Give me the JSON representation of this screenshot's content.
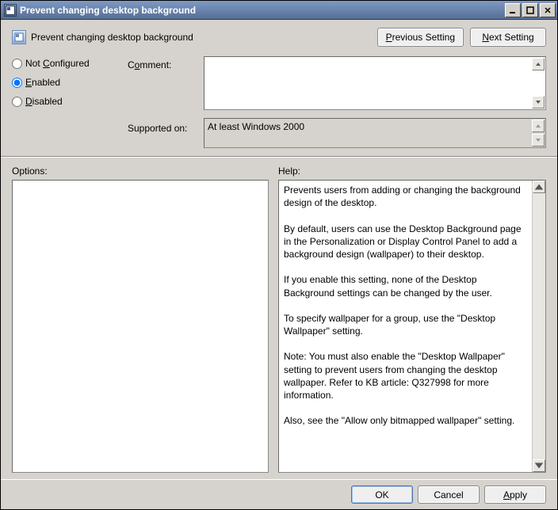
{
  "window": {
    "title": "Prevent changing desktop background"
  },
  "header": {
    "policy_name": "Prevent changing desktop background",
    "previous_label": "Previous Setting",
    "previous_hotkey": "P",
    "next_label": "Next Setting",
    "next_hotkey": "N"
  },
  "state": {
    "not_configured_label": "Not Configured",
    "not_configured_hotkey": "C",
    "enabled_label": "Enabled",
    "enabled_hotkey": "E",
    "disabled_label": "Disabled",
    "disabled_hotkey": "D",
    "selected": "enabled"
  },
  "comment": {
    "label": "Comment:",
    "hotkey": "o",
    "value": ""
  },
  "supported": {
    "label": "Supported on:",
    "value": "At least Windows 2000"
  },
  "panels": {
    "options_label": "Options:",
    "help_label": "Help:"
  },
  "help_text": "Prevents users from adding or changing the background design of the desktop.\n\nBy default, users can use the Desktop Background page in the Personalization or Display Control Panel to add a background design (wallpaper) to their desktop.\n\nIf you enable this setting, none of the Desktop Background settings can be changed by the user.\n\nTo specify wallpaper for a group, use the \"Desktop Wallpaper\" setting.\n\nNote: You must also enable the \"Desktop Wallpaper\" setting to prevent users from changing the desktop wallpaper. Refer to KB article: Q327998 for more information.\n\nAlso, see the \"Allow only bitmapped wallpaper\" setting.",
  "footer": {
    "ok_label": "OK",
    "cancel_label": "Cancel",
    "apply_label": "Apply",
    "apply_hotkey": "A"
  }
}
